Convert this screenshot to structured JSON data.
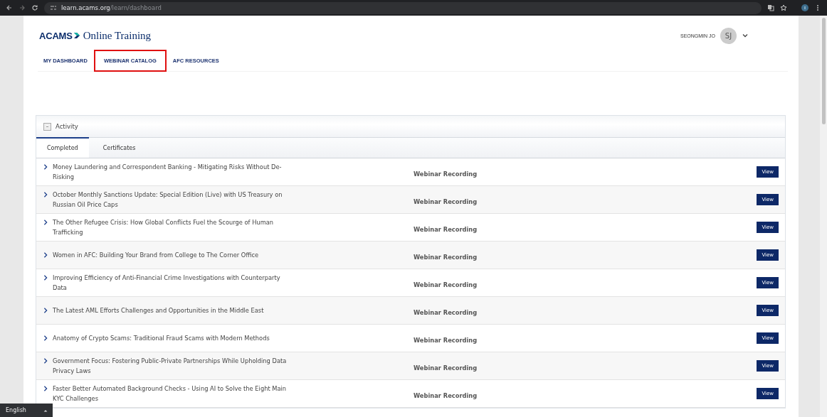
{
  "browser": {
    "url_host": "learn.acams.org",
    "url_path": "/learn/dashboard"
  },
  "header": {
    "logo": "ACAMS",
    "title": "Online Training",
    "user_name": "SEONGMIN JO",
    "avatar_initials": "SJ"
  },
  "nav": [
    {
      "label": "MY DASHBOARD",
      "highlighted": false
    },
    {
      "label": "WEBINAR CATALOG",
      "highlighted": true
    },
    {
      "label": "AFC RESOURCES",
      "highlighted": false
    }
  ],
  "panel": {
    "title": "Activity",
    "expanded": true,
    "tabs": [
      {
        "label": "Completed",
        "selected": true
      },
      {
        "label": "Certificates",
        "selected": false
      }
    ],
    "rows": [
      {
        "title": "Money Laundering and Correspondent Banking - Mitigating Risks Without De-Risking",
        "type": "Webinar Recording",
        "action": "View"
      },
      {
        "title": "October Monthly Sanctions Update: Special Edition (Live) with US Treasury on Russian Oil Price Caps",
        "type": "Webinar Recording",
        "action": "View"
      },
      {
        "title": "The Other Refugee Crisis: How Global Conflicts Fuel the Scourge of Human Trafficking",
        "type": "Webinar Recording",
        "action": "View"
      },
      {
        "title": "Women in AFC: Building Your Brand from College to The Corner Office",
        "type": "Webinar Recording",
        "action": "View"
      },
      {
        "title": "Improving Efficiency of Anti-Financial Crime Investigations with Counterparty Data",
        "type": "Webinar Recording",
        "action": "View"
      },
      {
        "title": "The Latest AML Efforts Challenges and Opportunities in the Middle East",
        "type": "Webinar Recording",
        "action": "View"
      },
      {
        "title": "Anatomy of Crypto Scams: Traditional Fraud Scams with Modern Methods",
        "type": "Webinar Recording",
        "action": "View"
      },
      {
        "title": "Government Focus: Fostering Public-Private Partnerships While Upholding Data Privacy Laws",
        "type": "Webinar Recording",
        "action": "View"
      },
      {
        "title": "Faster Better Automated Background Checks - Using AI to Solve the Eight Main KYC Challenges",
        "type": "Webinar Recording",
        "action": "View"
      }
    ]
  },
  "language": {
    "label": "English"
  }
}
